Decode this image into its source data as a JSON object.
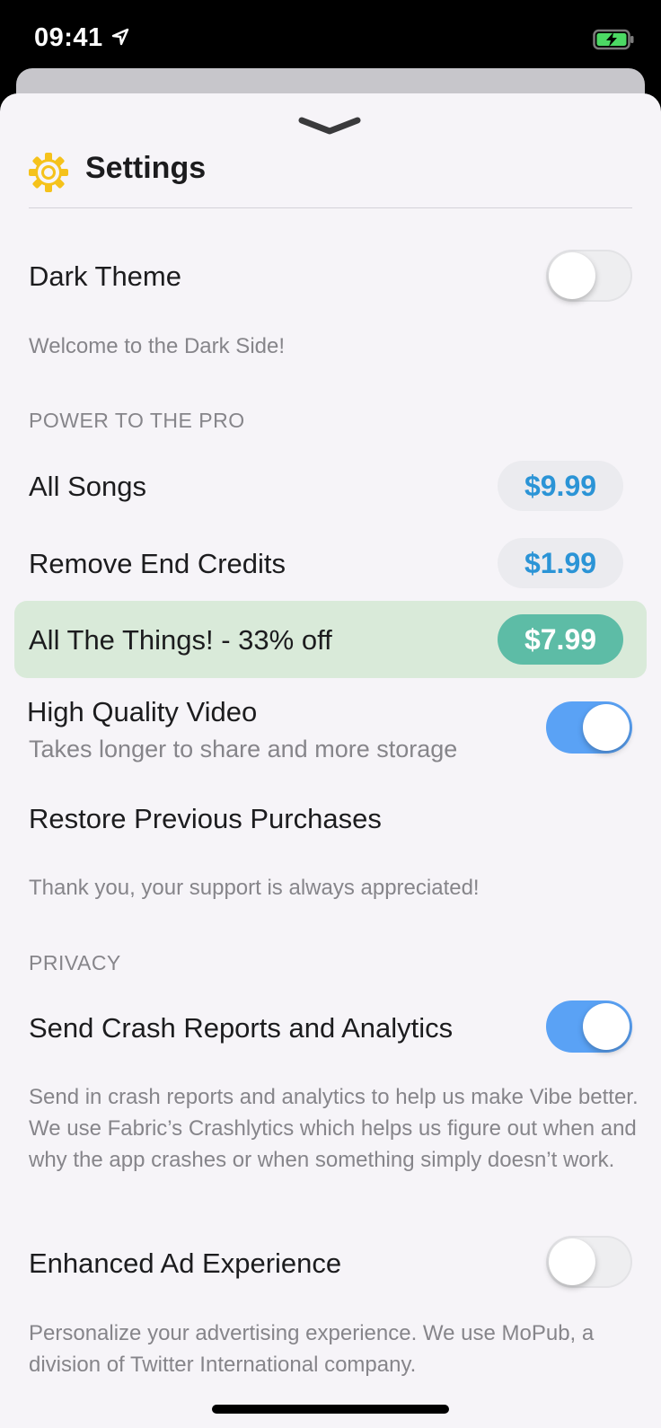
{
  "status_bar": {
    "time": "09:41"
  },
  "header": {
    "title": "Settings"
  },
  "dark_theme": {
    "label": "Dark Theme",
    "on": false,
    "footer": "Welcome to the Dark Side!"
  },
  "pro_section": {
    "header": "POWER TO THE PRO",
    "items": [
      {
        "label": "All Songs",
        "price": "$9.99"
      },
      {
        "label": "Remove End Credits",
        "price": "$1.99"
      },
      {
        "label": "All The Things! - 33% off",
        "price": "$7.99"
      }
    ],
    "hq_video": {
      "label": "High Quality Video",
      "sublabel": "Takes longer to share and more storage",
      "on": true
    },
    "restore": {
      "label": "Restore Previous Purchases"
    },
    "footer": "Thank you, your support is always appreciated!"
  },
  "privacy_section": {
    "header": "PRIVACY",
    "crash_reports": {
      "label": "Send Crash Reports and Analytics",
      "on": true,
      "footer": "Send in crash reports and analytics to help us make Vibe better. We use Fabric’s Crashlytics which helps us figure out when and why the app crashes or when something simply doesn’t work."
    },
    "enhanced_ads": {
      "label": "Enhanced Ad Experience",
      "on": false,
      "footer": "Personalize your advertising experience. We use MoPub, a division of Twitter International company."
    }
  },
  "colors": {
    "accent_toggle": "#5aa2f5",
    "price_text": "#2b94d6",
    "highlight_row": "#d9ead9",
    "highlight_price": "#5dbca6",
    "gear": "#f5c21b"
  },
  "icons": [
    "location-arrow-icon",
    "battery-charging-icon",
    "chevron-down-icon",
    "gear-icon"
  ]
}
